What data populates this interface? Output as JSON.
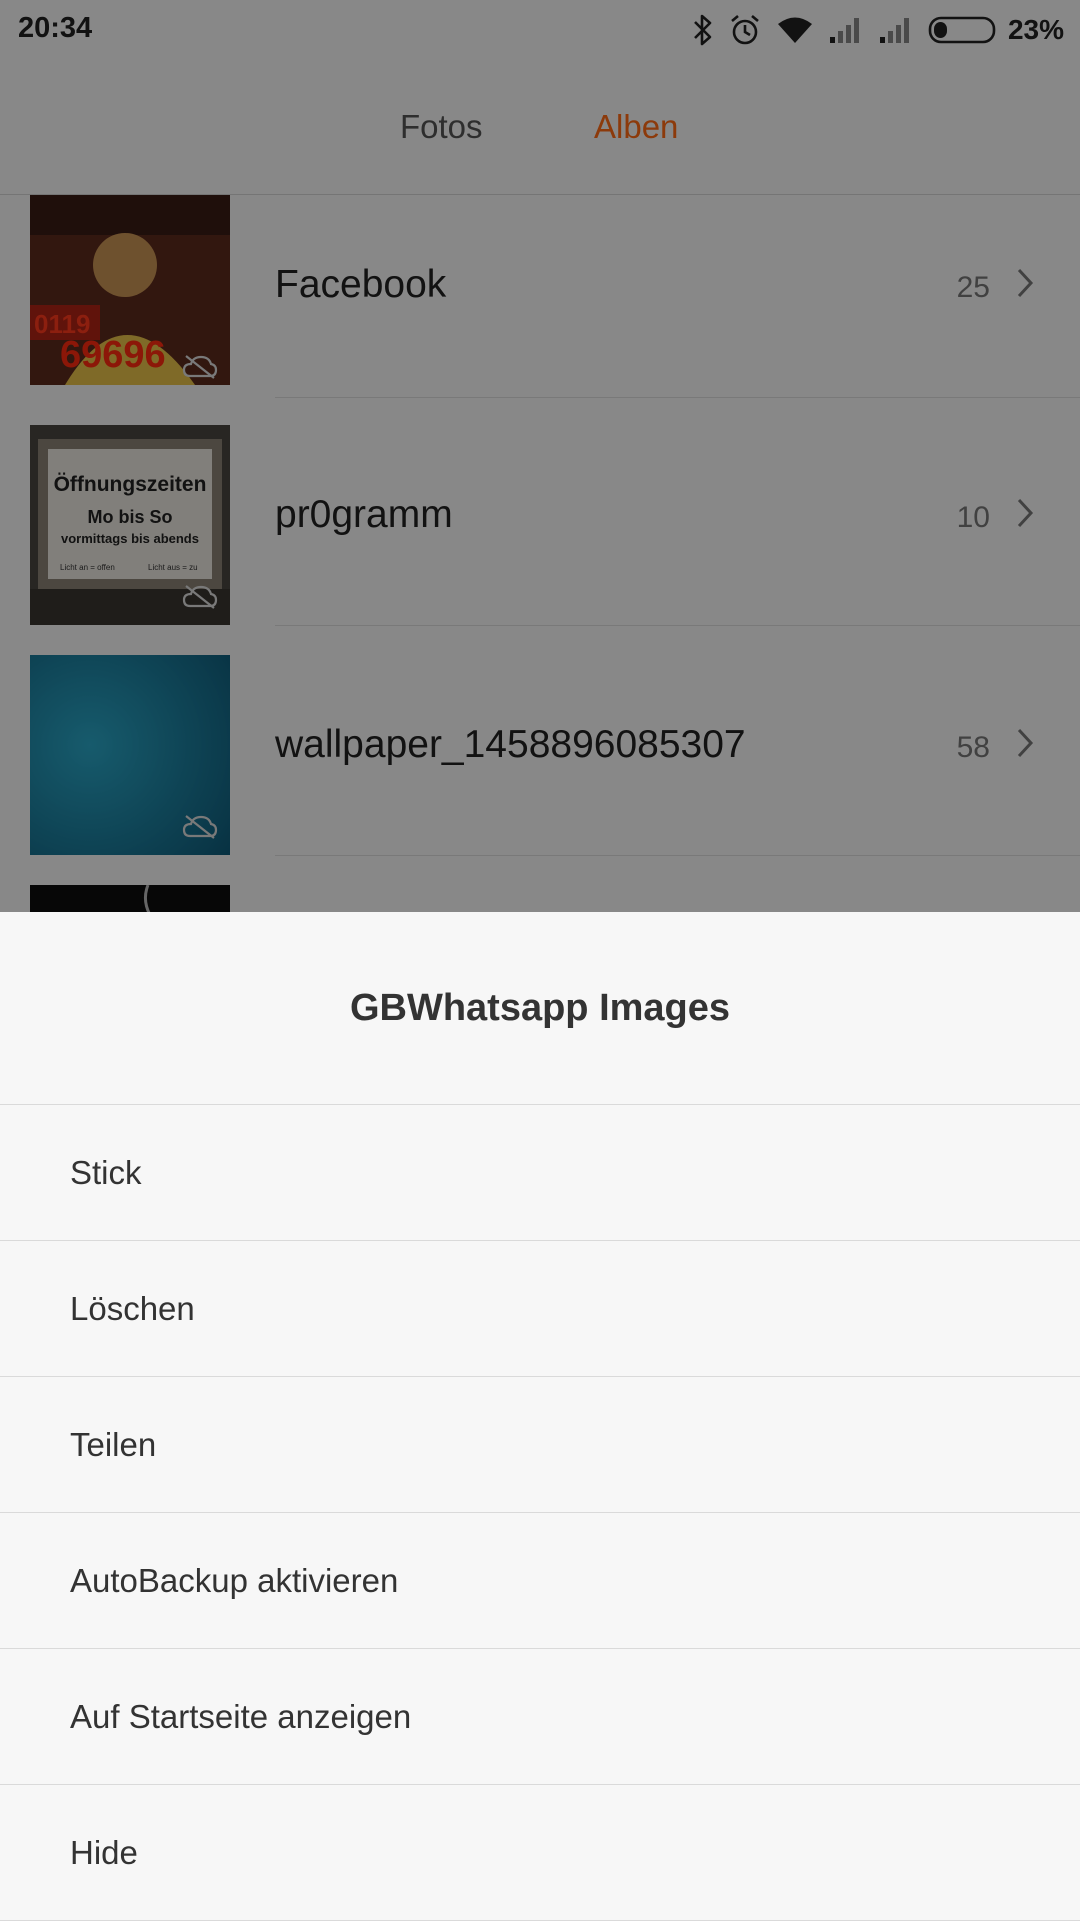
{
  "status_bar": {
    "time": "20:34",
    "battery_percent": "23%",
    "battery_level": 0.23,
    "icons": [
      "bluetooth-icon",
      "alarm-icon",
      "wifi-icon",
      "signal-icon",
      "signal-icon",
      "battery-icon"
    ]
  },
  "tabs": [
    {
      "label": "Fotos",
      "active": false
    },
    {
      "label": "Alben",
      "active": true
    }
  ],
  "accent_color": "#ff6a14",
  "albums": [
    {
      "name": "Facebook",
      "count": "25"
    },
    {
      "name": "pr0gramm",
      "count": "10"
    },
    {
      "name": "wallpaper_1458896085307",
      "count": "58"
    }
  ],
  "thumb_text": {
    "facebook": {
      "line1": "0119",
      "line2": "69696"
    },
    "program": {
      "heading": "Öffnungszeiten",
      "line1": "Mo bis So",
      "line2": "vormittags bis abends",
      "left": "Licht an = offen",
      "right": "Licht aus = zu"
    }
  },
  "sheet": {
    "title": "GBWhatsapp Images",
    "items": [
      {
        "label": "Stick"
      },
      {
        "label": "Löschen"
      },
      {
        "label": "Teilen"
      },
      {
        "label": "AutoBackup aktivieren"
      },
      {
        "label": "Auf Startseite anzeigen"
      },
      {
        "label": "Hide"
      }
    ]
  }
}
